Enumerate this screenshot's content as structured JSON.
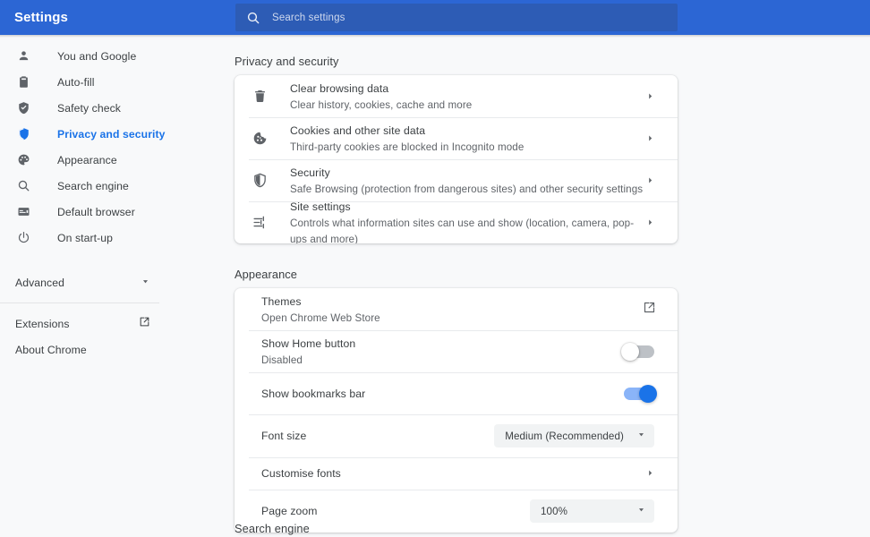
{
  "topbar": {
    "title": "Settings",
    "search_placeholder": "Search settings",
    "search_value": "",
    "bg_color": "#2c66d4",
    "search_bg_color": "#2d5cb5"
  },
  "sidebar": {
    "items": [
      {
        "label": "You and Google",
        "icon": "person-icon",
        "active": false
      },
      {
        "label": "Auto-fill",
        "icon": "clipboard-icon",
        "active": false
      },
      {
        "label": "Safety check",
        "icon": "shield-check-icon",
        "active": false
      },
      {
        "label": "Privacy and security",
        "icon": "shield-icon",
        "active": true
      },
      {
        "label": "Appearance",
        "icon": "palette-icon",
        "active": false
      },
      {
        "label": "Search engine",
        "icon": "search-icon",
        "active": false
      },
      {
        "label": "Default browser",
        "icon": "browser-window-icon",
        "active": false
      },
      {
        "label": "On start-up",
        "icon": "power-icon",
        "active": false
      }
    ],
    "advanced": {
      "label": "Advanced",
      "icon": "chevron-down-icon"
    },
    "footer": [
      {
        "label": "Extensions",
        "icon": "external-link-icon"
      },
      {
        "label": "About Chrome",
        "icon": ""
      }
    ],
    "active_color": "#1a73e8"
  },
  "main": {
    "sections": [
      {
        "heading": "Privacy and security",
        "rows": [
          {
            "title": "Clear browsing data",
            "subtitle": "Clear history, cookies, cache and more",
            "icon": "trash-icon",
            "control": "chevron-right-icon"
          },
          {
            "title": "Cookies and other site data",
            "subtitle": "Third-party cookies are blocked in Incognito mode",
            "icon": "cookie-icon",
            "control": "chevron-right-icon"
          },
          {
            "title": "Security",
            "subtitle": "Safe Browsing (protection from dangerous sites) and other security settings",
            "icon": "shield-icon",
            "control": "chevron-right-icon"
          },
          {
            "title": "Site settings",
            "subtitle": "Controls what information sites can use and show (location, camera, pop-ups and more)",
            "icon": "tune-icon",
            "control": "chevron-right-icon"
          }
        ]
      },
      {
        "heading": "Appearance",
        "rows": [
          {
            "title": "Themes",
            "subtitle": "Open Chrome Web Store",
            "icon": "",
            "control": "external-link-icon"
          },
          {
            "title": "Show Home button",
            "subtitle": "Disabled",
            "icon": "",
            "control": "toggle-off"
          },
          {
            "title": "Show bookmarks bar",
            "subtitle": "",
            "icon": "",
            "control": "toggle-on"
          },
          {
            "title": "Font size",
            "subtitle": "",
            "icon": "",
            "control": "select",
            "value": "Medium (Recommended)"
          },
          {
            "title": "Customise fonts",
            "subtitle": "",
            "icon": "",
            "control": "chevron-right-icon"
          },
          {
            "title": "Page zoom",
            "subtitle": "",
            "icon": "",
            "control": "select",
            "value": "100%"
          }
        ]
      },
      {
        "heading": "Search engine",
        "rows": []
      }
    ]
  }
}
